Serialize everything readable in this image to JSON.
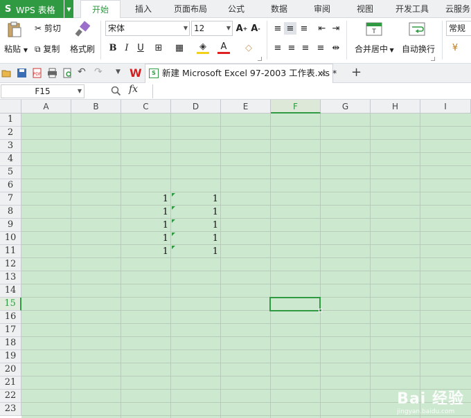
{
  "app": {
    "name": "WPS 表格",
    "logo": "S",
    "brand_color": "#2f9a41"
  },
  "menu_tabs": [
    {
      "label": "开始",
      "active": true
    },
    {
      "label": "插入"
    },
    {
      "label": "页面布局"
    },
    {
      "label": "公式"
    },
    {
      "label": "数据"
    },
    {
      "label": "审阅"
    },
    {
      "label": "视图"
    },
    {
      "label": "开发工具"
    },
    {
      "label": "云服务"
    }
  ],
  "ribbon": {
    "paste": "粘贴",
    "cut": "剪切",
    "copy": "复制",
    "format_painter": "格式刷",
    "font_name": "宋体",
    "font_size": "12",
    "bold": "B",
    "italic": "I",
    "underline": "U",
    "merge_center": "合并居中",
    "wrap_text": "自动换行",
    "number_format": "常规"
  },
  "document": {
    "tab_title": "新建 Microsoft Excel 97-2003 工作表.xls *",
    "new_tab": "+"
  },
  "formula_bar": {
    "name_box": "F15",
    "fx": "fx",
    "content": ""
  },
  "sheet": {
    "columns": [
      "A",
      "B",
      "C",
      "D",
      "E",
      "F",
      "G",
      "H",
      "I"
    ],
    "selected_column": "F",
    "rows": [
      "1",
      "2",
      "3",
      "4",
      "5",
      "6",
      "7",
      "8",
      "9",
      "10",
      "11",
      "12",
      "13",
      "14",
      "15",
      "16",
      "17",
      "18",
      "19",
      "20",
      "21",
      "22",
      "23"
    ],
    "selected_row": "15",
    "cells": [
      {
        "ref": "C7",
        "value": "1"
      },
      {
        "ref": "D7",
        "value": "1"
      },
      {
        "ref": "C8",
        "value": "1"
      },
      {
        "ref": "D8",
        "value": "1"
      },
      {
        "ref": "C9",
        "value": "1"
      },
      {
        "ref": "D9",
        "value": "1"
      },
      {
        "ref": "C10",
        "value": "1"
      },
      {
        "ref": "D10",
        "value": "1"
      },
      {
        "ref": "C11",
        "value": "1"
      },
      {
        "ref": "D11",
        "value": "1"
      }
    ],
    "selected_cell": "F15",
    "cell_background": "#cce8cf"
  },
  "watermark": {
    "brand": "Bai 经验",
    "url": "jingyan.baidu.com"
  }
}
